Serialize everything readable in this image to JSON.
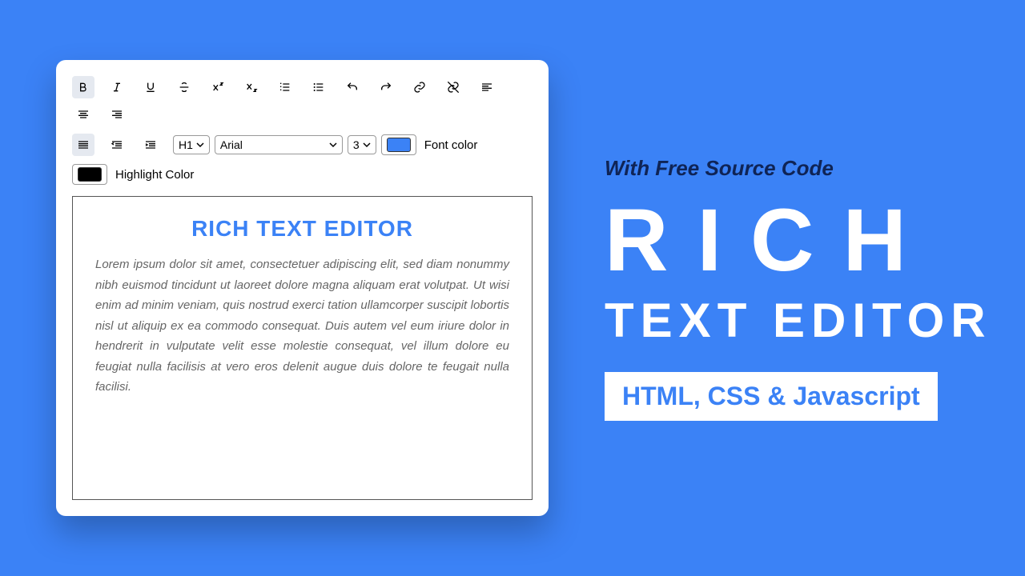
{
  "toolbar": {
    "heading": "H1",
    "font": "Arial",
    "size": "3",
    "font_color_label": "Font color",
    "highlight_label": "Highlight Color"
  },
  "editor": {
    "title": "RICH TEXT EDITOR",
    "body": "Lorem ipsum dolor sit amet, consectetuer adipiscing elit, sed diam nonummy nibh euismod tincidunt ut laoreet dolore magna aliquam erat volutpat. Ut wisi enim ad minim veniam, quis nostrud exerci tation ullamcorper suscipit lobortis nisl ut aliquip ex ea commodo consequat. Duis autem vel eum iriure dolor in hendrerit in vulputate velit esse molestie consequat, vel illum dolore eu feugiat nulla facilisis at vero eros delenit augue duis dolore te feugait nulla facilisi."
  },
  "promo": {
    "tagline": "With Free Source Code",
    "rich": "RICH",
    "sub": "TEXT EDITOR",
    "badge": "HTML, CSS & Javascript"
  }
}
